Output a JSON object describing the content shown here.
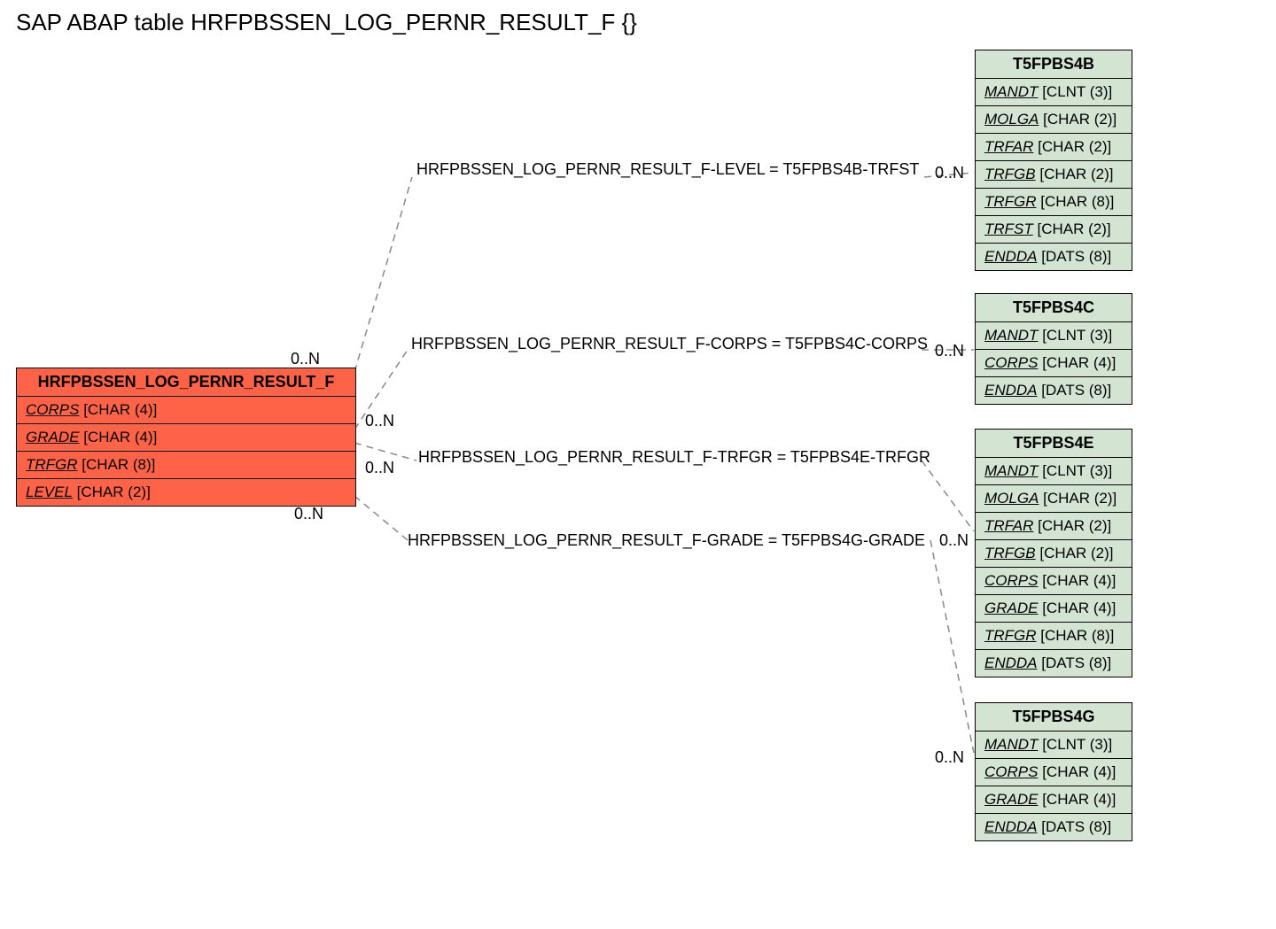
{
  "title": "SAP ABAP table HRFPBSSEN_LOG_PERNR_RESULT_F {}",
  "main_entity": {
    "name": "HRFPBSSEN_LOG_PERNR_RESULT_F",
    "fields": [
      {
        "name": "CORPS",
        "type": "[CHAR (4)]"
      },
      {
        "name": "GRADE",
        "type": "[CHAR (4)]"
      },
      {
        "name": "TRFGR",
        "type": "[CHAR (8)]"
      },
      {
        "name": "LEVEL",
        "type": "[CHAR (2)]"
      }
    ]
  },
  "related": [
    {
      "name": "T5FPBS4B",
      "fields": [
        {
          "name": "MANDT",
          "type": "[CLNT (3)]"
        },
        {
          "name": "MOLGA",
          "type": "[CHAR (2)]"
        },
        {
          "name": "TRFAR",
          "type": "[CHAR (2)]"
        },
        {
          "name": "TRFGB",
          "type": "[CHAR (2)]"
        },
        {
          "name": "TRFGR",
          "type": "[CHAR (8)]"
        },
        {
          "name": "TRFST",
          "type": "[CHAR (2)]"
        },
        {
          "name": "ENDDA",
          "type": "[DATS (8)]"
        }
      ]
    },
    {
      "name": "T5FPBS4C",
      "fields": [
        {
          "name": "MANDT",
          "type": "[CLNT (3)]"
        },
        {
          "name": "CORPS",
          "type": "[CHAR (4)]"
        },
        {
          "name": "ENDDA",
          "type": "[DATS (8)]"
        }
      ]
    },
    {
      "name": "T5FPBS4E",
      "fields": [
        {
          "name": "MANDT",
          "type": "[CLNT (3)]"
        },
        {
          "name": "MOLGA",
          "type": "[CHAR (2)]"
        },
        {
          "name": "TRFAR",
          "type": "[CHAR (2)]"
        },
        {
          "name": "TRFGB",
          "type": "[CHAR (2)]"
        },
        {
          "name": "CORPS",
          "type": "[CHAR (4)]"
        },
        {
          "name": "GRADE",
          "type": "[CHAR (4)]"
        },
        {
          "name": "TRFGR",
          "type": "[CHAR (8)]"
        },
        {
          "name": "ENDDA",
          "type": "[DATS (8)]"
        }
      ]
    },
    {
      "name": "T5FPBS4G",
      "fields": [
        {
          "name": "MANDT",
          "type": "[CLNT (3)]"
        },
        {
          "name": "CORPS",
          "type": "[CHAR (4)]"
        },
        {
          "name": "GRADE",
          "type": "[CHAR (4)]"
        },
        {
          "name": "ENDDA",
          "type": "[DATS (8)]"
        }
      ]
    }
  ],
  "relations": [
    {
      "label": "HRFPBSSEN_LOG_PERNR_RESULT_F-LEVEL = T5FPBS4B-TRFST",
      "left_card": "0..N",
      "right_card": "0..N"
    },
    {
      "label": "HRFPBSSEN_LOG_PERNR_RESULT_F-CORPS = T5FPBS4C-CORPS",
      "left_card": "0..N",
      "right_card": "0..N"
    },
    {
      "label": "HRFPBSSEN_LOG_PERNR_RESULT_F-TRFGR = T5FPBS4E-TRFGR",
      "left_card": "0..N",
      "right_card": "0..N"
    },
    {
      "label": "HRFPBSSEN_LOG_PERNR_RESULT_F-GRADE = T5FPBS4G-GRADE",
      "left_card": "0..N",
      "right_card": "0..N"
    }
  ]
}
